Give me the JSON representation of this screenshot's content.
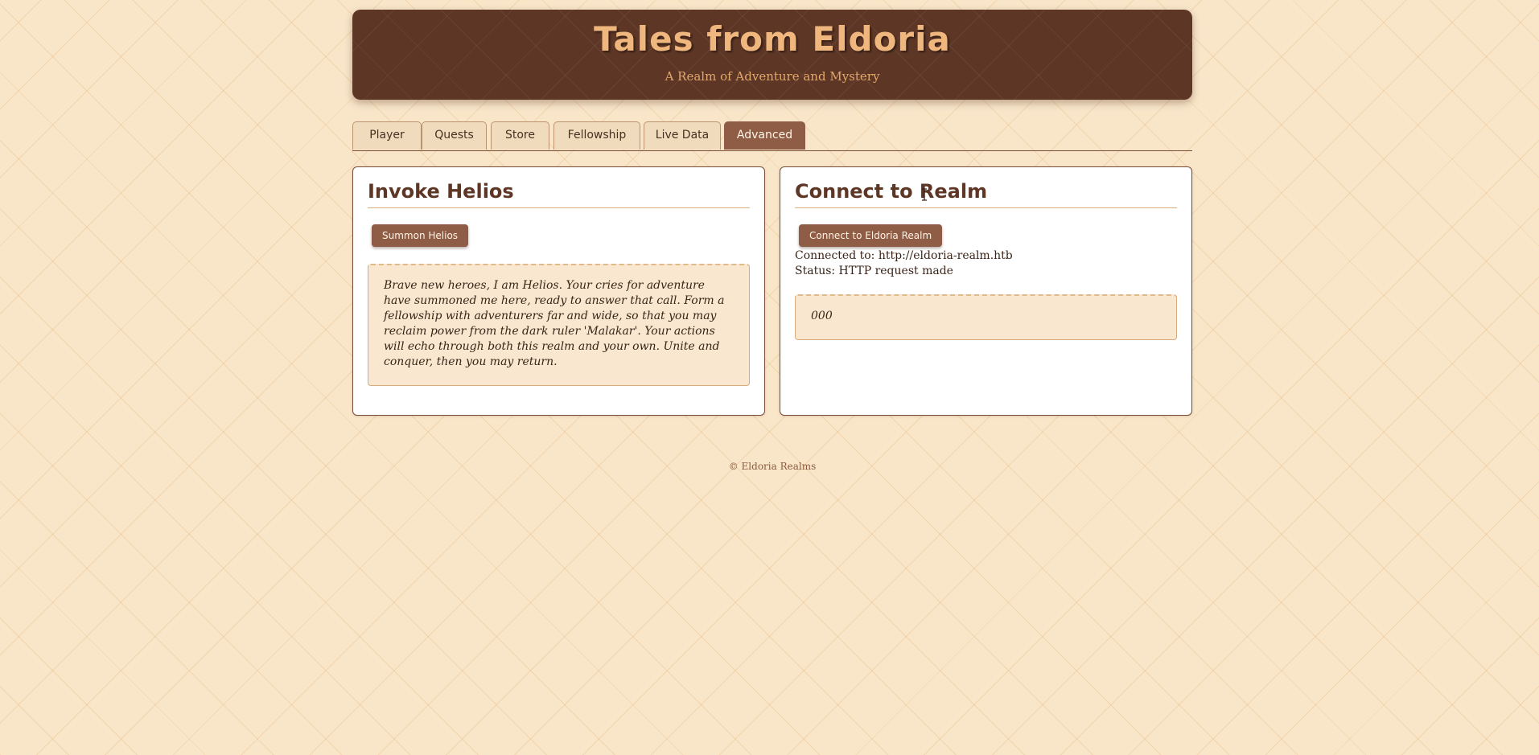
{
  "header": {
    "title": "Tales from Eldoria",
    "subtitle": "A Realm of Adventure and Mystery"
  },
  "tabs": [
    {
      "label": "Player",
      "active": false
    },
    {
      "label": "Quests",
      "active": false
    },
    {
      "label": "Store",
      "active": false
    },
    {
      "label": "Fellowship",
      "active": false
    },
    {
      "label": "Live Data",
      "active": false
    },
    {
      "label": "Advanced",
      "active": true
    }
  ],
  "helios_panel": {
    "title": "Invoke Helios",
    "button_label": "Summon Helios",
    "message": "Brave new heroes, I am Helios. Your cries for adventure have summoned me here, ready to answer that call. Form a fellowship with adventurers far and wide, so that you may reclaim power from the dark ruler 'Malakar'. Your actions will echo through both this realm and your own. Unite and conquer, then you may return."
  },
  "realm_panel": {
    "title": "Connect to Realm",
    "button_label": "Connect to Eldoria Realm",
    "connected_line": "Connected to: http://eldoria-realm.htb",
    "status_line": "Status: HTTP request made",
    "response": "000"
  },
  "footer": {
    "text": "© Eldoria Realms"
  },
  "icons": {
    "cursor": "text-cursor-icon"
  },
  "colors": {
    "header_bg": "#5e3626",
    "title_gold": "#efb77e",
    "accent_brown": "#8f5c45",
    "page_bg": "#f9e6c9"
  }
}
